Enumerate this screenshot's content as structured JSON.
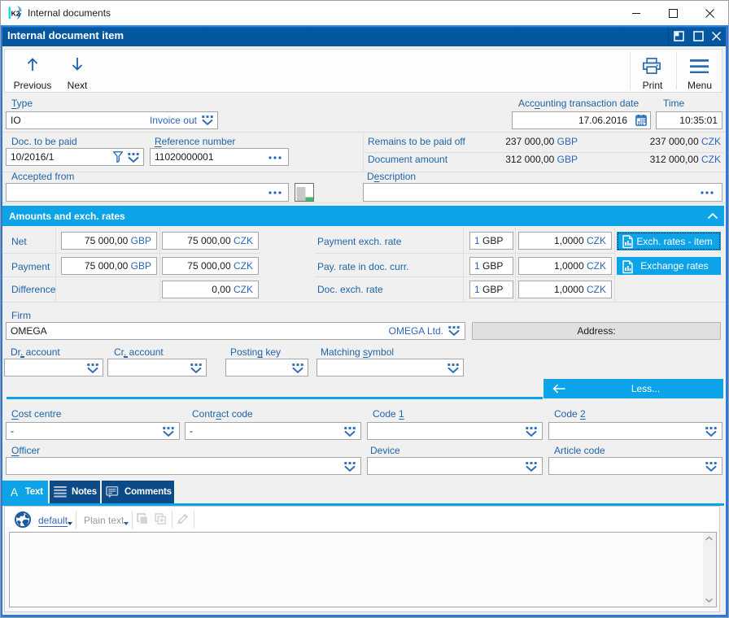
{
  "window": {
    "title": "Internal documents",
    "logo_text": "K2"
  },
  "form": {
    "caption": "Internal document item"
  },
  "toolbar": {
    "previous": "Previous",
    "next": "Next",
    "print": "Print",
    "menu": "Menu"
  },
  "labels": {
    "type": {
      "pre": "",
      "acc": "T",
      "post": "ype"
    },
    "acc_date": {
      "pre": "Acc",
      "acc": "o",
      "post": "unting transaction date"
    },
    "time": "Time",
    "doc_to_be_paid": "Doc. to be paid",
    "reference": {
      "pre": "",
      "acc": "R",
      "post": "eference number"
    },
    "remains": "Remains to be paid off",
    "doc_amount": "Document amount",
    "accepted_from": "Accepted from",
    "description": {
      "pre": "D",
      "acc": "e",
      "post": "scription"
    },
    "net": "Net",
    "payment": "Payment",
    "difference": "Difference",
    "payment_exch_rate": "Payment exch. rate",
    "pay_rate_doc_curr": "Pay. rate in doc. curr.",
    "doc_exch_rate": "Doc. exch. rate",
    "firm": "Firm",
    "address": "Address:",
    "dr_account": {
      "pre": "Dr",
      "acc": ".",
      "post": " account"
    },
    "cr_account": {
      "pre": "Cr",
      "acc": ".",
      "post": " account"
    },
    "posting_key": {
      "pre": "Postin",
      "acc": "g",
      "post": " key"
    },
    "matching_symbol": {
      "pre": "Matching ",
      "acc": "s",
      "post": "ymbol"
    },
    "cost_centre": {
      "pre": "",
      "acc": "C",
      "post": "ost centre"
    },
    "contract_code": {
      "pre": "Contr",
      "acc": "a",
      "post": "ct code"
    },
    "code1": {
      "pre": "Code ",
      "acc": "1",
      "post": ""
    },
    "code2": {
      "pre": "Code ",
      "acc": "2",
      "post": ""
    },
    "officer": {
      "pre": "",
      "acc": "O",
      "post": "fficer"
    },
    "device": "Device",
    "article_code": "Article code"
  },
  "values": {
    "type_code": "IO",
    "type_name": "Invoice out",
    "acc_date": "17.06.2016",
    "time": "10:35:01",
    "doc_to_be_paid": "10/2016/1",
    "reference": "11020000001",
    "remains_gbp_num": "237 000,00",
    "remains_gbp_cur": "GBP",
    "remains_czk_num": "237 000,00",
    "remains_czk_cur": "CZK",
    "amount_gbp_num": "312 000,00",
    "amount_gbp_cur": "GBP",
    "amount_czk_num": "312 000,00",
    "amount_czk_cur": "CZK",
    "net_gbp_num": "75 000,00",
    "net_gbp_cur": "GBP",
    "net_czk_num": "75 000,00",
    "net_czk_cur": "CZK",
    "payment_gbp_num": "75 000,00",
    "payment_gbp_cur": "GBP",
    "payment_czk_num": "75 000,00",
    "payment_czk_cur": "CZK",
    "diff_czk_num": "0,00",
    "diff_czk_cur": "CZK",
    "rate1_unit_num": "1",
    "rate1_unit_cur": "GBP",
    "rate1_val_num": "1,0000",
    "rate1_val_cur": "CZK",
    "rate2_unit_num": "1",
    "rate2_unit_cur": "GBP",
    "rate2_val_num": "1,0000",
    "rate2_val_cur": "CZK",
    "rate3_unit_num": "1",
    "rate3_unit_cur": "GBP",
    "rate3_val_num": "1,0000",
    "rate3_val_cur": "CZK",
    "firm_code": "OMEGA",
    "firm_name": "OMEGA Ltd.",
    "cost_centre": "-",
    "contract_code": "-"
  },
  "sections": {
    "amounts": "Amounts and exch. rates"
  },
  "buttons": {
    "exch_rates_item": "Exch. rates - item",
    "exchange_rates": "Exchange rates",
    "less": "Less..."
  },
  "tabs": [
    {
      "label": "Text"
    },
    {
      "label": "Notes"
    },
    {
      "label": "Comments"
    }
  ],
  "editor": {
    "language": "default",
    "format": "Plain text"
  },
  "colors": {
    "caption_blue": "#04559c",
    "cyan": "#0ca3e8",
    "navy": "#0d4a88",
    "label_blue": "#1f63a8",
    "currency_blue": "#2d66b8",
    "window_border_blue": "#2b79dc"
  }
}
